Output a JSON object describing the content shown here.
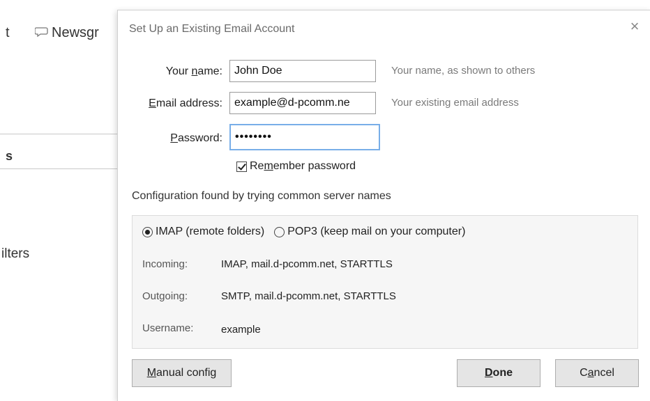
{
  "background": {
    "menu_t": "t",
    "newsgroups_label": "Newsgr",
    "section_s": "s",
    "filters_label": "ilters"
  },
  "dialog": {
    "title": "Set Up an Existing Email Account",
    "close_glyph": "×",
    "name_label_pre": "Your ",
    "name_label_key": "n",
    "name_label_post": "ame:",
    "name_value": "John Doe",
    "name_hint": "Your name, as shown to others",
    "email_label_key": "E",
    "email_label_post": "mail address:",
    "email_value": "example@d-pcomm.ne",
    "email_hint": "Your existing email address",
    "password_label_key": "P",
    "password_label_post": "assword:",
    "password_value": "••••••••",
    "remember_pre": "Re",
    "remember_key": "m",
    "remember_post": "ember password",
    "remember_checked": true,
    "config_message": "Configuration found by trying common server names",
    "imap_label": "IMAP (remote folders)",
    "pop3_label": "POP3 (keep mail on your computer)",
    "protocol_selected": "IMAP",
    "incoming_label": "Incoming:",
    "incoming_value": "IMAP, mail.d-pcomm.net, STARTTLS",
    "outgoing_label": "Outgoing:",
    "outgoing_value": "SMTP, mail.d-pcomm.net, STARTTLS",
    "username_label": "Username:",
    "username_value": "example",
    "manual_key": "M",
    "manual_post": "anual config",
    "done_pre": "",
    "done_key": "D",
    "done_post": "one",
    "cancel_pre": "C",
    "cancel_key": "a",
    "cancel_post": "ncel"
  }
}
